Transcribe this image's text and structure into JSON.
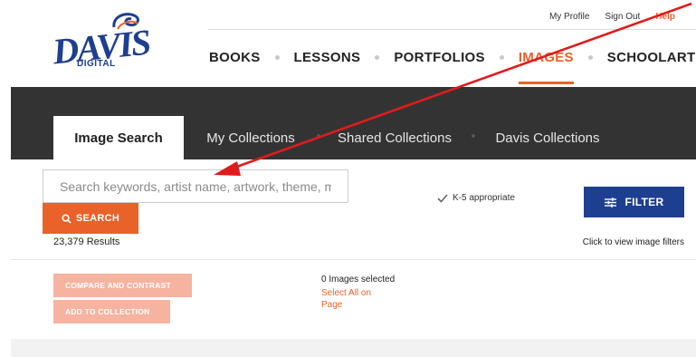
{
  "brand": {
    "logo_word": "DAVIS",
    "logo_sub": "DIGITAL",
    "primary": "#1e3f8f",
    "accent": "#e8622a"
  },
  "toplinks": {
    "profile": "My Profile",
    "signout": "Sign Out",
    "help": "Help"
  },
  "nav": {
    "items": [
      "BOOKS",
      "LESSONS",
      "PORTFOLIOS",
      "IMAGES",
      "SCHOOLARTS"
    ],
    "active": "IMAGES"
  },
  "tabs": {
    "image_search": "Image Search",
    "my_collections": "My Collections",
    "shared_collections": "Shared Collections",
    "davis_collections": "Davis Collections"
  },
  "search": {
    "placeholder": "Search keywords, artist name, artwork, theme, med",
    "button": "SEARCH",
    "results": "23,379 Results"
  },
  "filters": {
    "k5_label": "K-5 appropriate",
    "k5_checked": true,
    "filter_button": "FILTER",
    "hint": "Click to view image filters"
  },
  "actions": {
    "compare": "COMPARE AND CONTRAST",
    "add_to_collection": "ADD TO COLLECTION",
    "selected_count": "0 Images selected",
    "select_all": "Select All on Page"
  },
  "annotation": {
    "arrow_color": "#e01b1b"
  }
}
